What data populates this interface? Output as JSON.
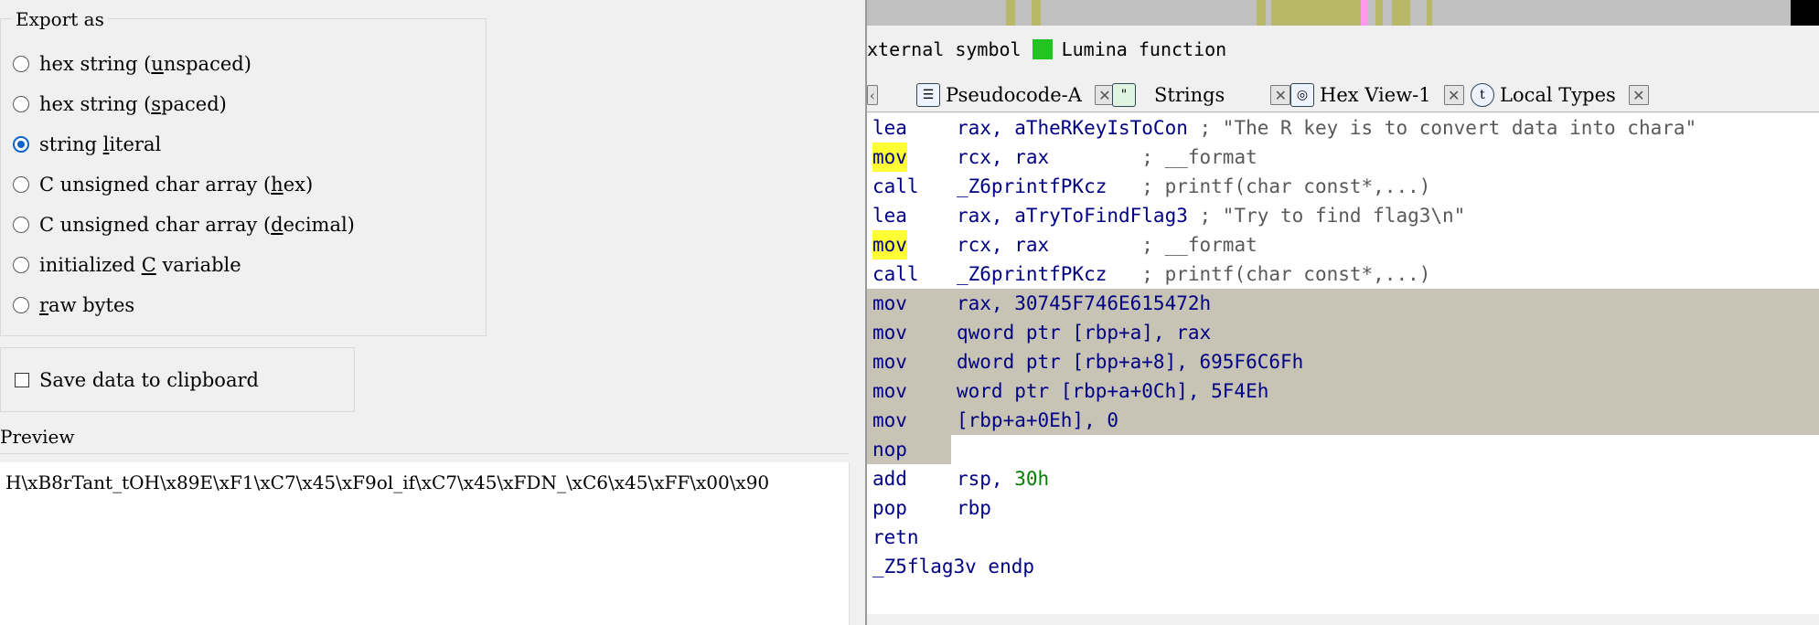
{
  "export_dialog": {
    "export_group_title": "Export as",
    "options": [
      {
        "pre": "hex string (",
        "mnemonic": "u",
        "post": "nspaced)",
        "checked": false
      },
      {
        "pre": "hex string (",
        "mnemonic": "s",
        "post": "paced)",
        "checked": false
      },
      {
        "pre": "string ",
        "mnemonic": "l",
        "post": "iteral",
        "checked": true
      },
      {
        "pre": "C unsigned char array (",
        "mnemonic": "h",
        "post": "ex)",
        "checked": false
      },
      {
        "pre": "C unsigned char array (",
        "mnemonic": "d",
        "post": "ecimal)",
        "checked": false
      },
      {
        "pre": "initialized ",
        "mnemonic": "C",
        "post": " variable",
        "checked": false
      },
      {
        "pre": "",
        "mnemonic": "r",
        "post": "aw bytes",
        "checked": false
      }
    ],
    "clipboard_label": "Save data to clipboard",
    "clipboard_checked": false,
    "preview_title": "Preview",
    "preview_text": "H\\xB8rTant_tOH\\x89E\\xF1\\xC7\\x45\\xF9ol_if\\xC7\\x45\\xFDN_\\xC6\\x45\\xFF\\x00\\x90"
  },
  "ida": {
    "legend": {
      "prefix_text": "xternal symbol",
      "lumina_label": "Lumina function",
      "lumina_color": "#22c322"
    },
    "tabs": [
      {
        "label": "Pseudocode-A",
        "icon": "pseudocode-icon"
      },
      {
        "label": "Strings",
        "icon": "strings-icon"
      },
      {
        "label": "Hex View-1",
        "icon": "hex-view-icon"
      },
      {
        "label": "Local Types",
        "icon": "local-types-icon"
      }
    ],
    "code_lines": [
      {
        "mnemonic": "lea",
        "operands": "rax, aTheRKeyIsToCon",
        "comment": " ; \"The R key is to convert data into chara\"",
        "selected": false,
        "highlight": false
      },
      {
        "mnemonic": "mov",
        "operands": "rcx, rax",
        "comment": "        ; __format",
        "selected": false,
        "highlight": true
      },
      {
        "mnemonic": "call",
        "operands": "_Z6printfPKcz",
        "comment": "   ; printf(char const*,...)",
        "selected": false,
        "highlight": false
      },
      {
        "mnemonic": "lea",
        "operands": "rax, aTryToFindFlag3",
        "comment": " ; \"Try to find flag3\\n\"",
        "selected": false,
        "highlight": false
      },
      {
        "mnemonic": "mov",
        "operands": "rcx, rax",
        "comment": "        ; __format",
        "selected": false,
        "highlight": true
      },
      {
        "mnemonic": "call",
        "operands": "_Z6printfPKcz",
        "comment": "   ; printf(char const*,...)",
        "selected": false,
        "highlight": false
      },
      {
        "mnemonic": "mov",
        "operands": "rax, 30745F746E615472h",
        "comment": "",
        "selected": true,
        "highlight": false
      },
      {
        "mnemonic": "mov",
        "operands": "qword ptr [rbp+a], rax",
        "comment": "",
        "selected": true,
        "highlight": false
      },
      {
        "mnemonic": "mov",
        "operands": "dword ptr [rbp+a+8], 695F6C6Fh",
        "comment": "",
        "selected": true,
        "highlight": false
      },
      {
        "mnemonic": "mov",
        "operands": "word ptr [rbp+a+0Ch], 5F4Eh",
        "comment": "",
        "selected": true,
        "highlight": false
      },
      {
        "mnemonic": "mov",
        "operands": "[rbp+a+0Eh], 0",
        "comment": "",
        "selected": true,
        "highlight": false
      },
      {
        "mnemonic": "nop",
        "operands": "",
        "comment": "",
        "selected": "partial",
        "highlight": false
      },
      {
        "mnemonic": "add",
        "operands_plain": "rsp, ",
        "operands_num": "30h",
        "comment": "",
        "selected": false,
        "highlight": false
      },
      {
        "mnemonic": "pop",
        "operands": "rbp",
        "comment": "",
        "selected": false,
        "highlight": false
      },
      {
        "mnemonic": "retn",
        "operands": "",
        "comment": "",
        "selected": false,
        "highlight": false
      }
    ],
    "endp_line": "_Z5flag3v endp",
    "colors": {
      "selection": "#c8c4b5",
      "highlight": "#ffff33",
      "mnemonic": "#000084",
      "number": "#008000",
      "comment": "#5a5a5a"
    }
  }
}
